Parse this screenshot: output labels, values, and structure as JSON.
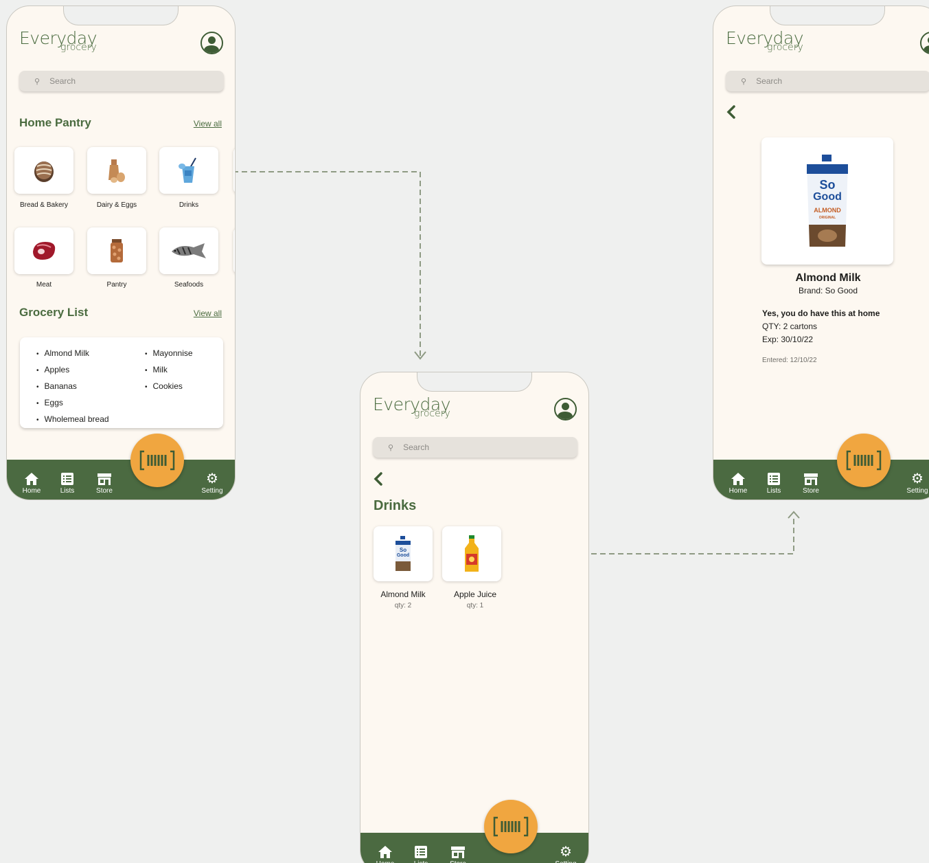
{
  "app": {
    "logo_main": "Everyday",
    "logo_sub": "grocery",
    "search_placeholder": "Search",
    "tabs": [
      "Home",
      "Lists",
      "Store",
      "Setting"
    ]
  },
  "home": {
    "pantry_title": "Home Pantry",
    "view_all": "View all",
    "categories": [
      "Bread & Bakery",
      "Dairy & Eggs",
      "Drinks",
      "Meat",
      "Pantry",
      "Seafoods"
    ],
    "grocery_title": "Grocery List",
    "grocery_view_all": "View all",
    "grocery_left": [
      "Almond Milk",
      "Apples",
      "Bananas",
      "Eggs",
      "Wholemeal bread"
    ],
    "grocery_right": [
      "Mayonnise",
      "Milk",
      "Cookies"
    ]
  },
  "drinks": {
    "title": "Drinks",
    "items": [
      {
        "name": "Almond Milk",
        "qty": "qty: 2"
      },
      {
        "name": "Apple Juice",
        "qty": "qty: 1"
      }
    ]
  },
  "detail": {
    "name": "Almond Milk",
    "brand": "Brand: So Good",
    "status": "Yes, you do have this at home",
    "qty": "QTY: 2 cartons",
    "exp": "Exp: 30/10/22",
    "entered": "Entered: 12/10/22",
    "carton_brand": "So Good",
    "carton_variant": "ALMOND",
    "carton_sub": "ORIGINAL"
  },
  "colors": {
    "accent_green": "#4a6b3f",
    "tabbar_green": "#4b6a41",
    "scan_orange": "#f0a640",
    "phone_bg": "#fdf8f1",
    "canvas_bg": "#eff0ef"
  },
  "icons": [
    "search-icon",
    "avatar-icon",
    "home-icon",
    "list-icon",
    "store-icon",
    "gear-icon",
    "barcode-icon",
    "back-chevron-icon"
  ]
}
